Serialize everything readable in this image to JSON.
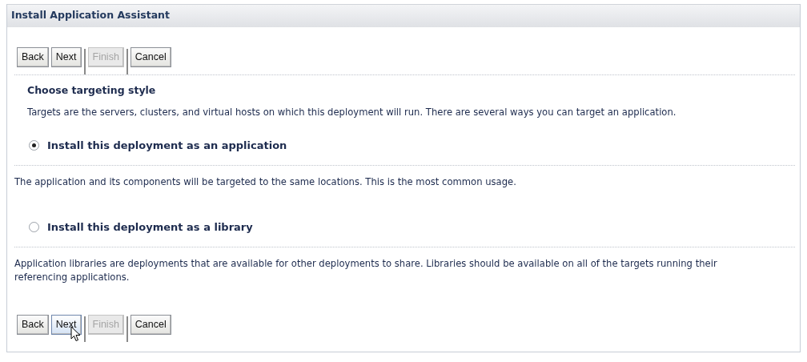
{
  "panel": {
    "title": "Install Application Assistant"
  },
  "top_buttons": [
    {
      "label": "Back",
      "disabled": false,
      "hovered": false
    },
    {
      "label": "Next",
      "disabled": false,
      "hovered": false
    },
    {
      "label": "Finish",
      "disabled": true,
      "hovered": false
    },
    {
      "label": "Cancel",
      "disabled": false,
      "hovered": false
    }
  ],
  "heading": "Choose targeting style",
  "intro": "Targets are the servers, clusters, and virtual hosts on which this deployment will run. There are several ways you can target an application.",
  "options": [
    {
      "label": "Install this deployment as an application",
      "selected": true,
      "description": "The application and its components will be targeted to the same locations. This is the most common usage."
    },
    {
      "label": "Install this deployment as a library",
      "selected": false,
      "description": "Application libraries are deployments that are available for other deployments to share. Libraries should be available on all of the targets running their referencing applications."
    }
  ],
  "bottom_buttons": [
    {
      "label": "Back",
      "disabled": false,
      "hovered": false
    },
    {
      "label": "Next",
      "disabled": false,
      "hovered": true
    },
    {
      "label": "Finish",
      "disabled": true,
      "hovered": false
    },
    {
      "label": "Cancel",
      "disabled": false,
      "hovered": false
    }
  ]
}
